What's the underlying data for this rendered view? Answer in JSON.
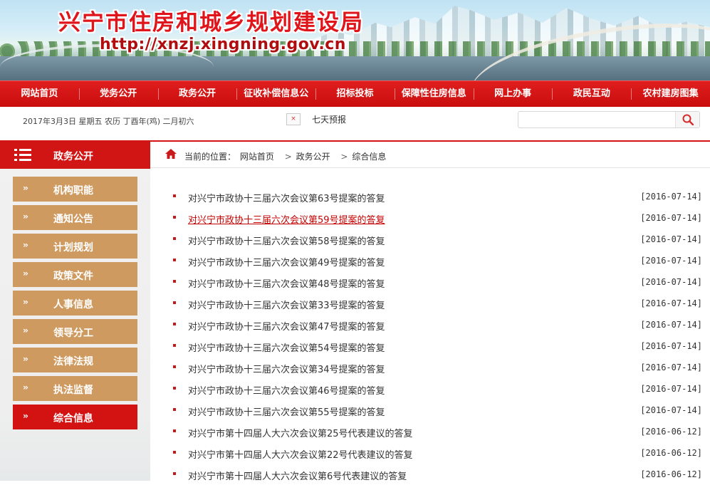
{
  "header": {
    "site_title": "兴宁市住房和城乡规划建设局",
    "site_url": "http://xnzj.xingning.gov.cn"
  },
  "nav": {
    "items": [
      "网站首页",
      "党务公开",
      "政务公开",
      "征收补偿信息公",
      "招标投标",
      "保障性住房信息",
      "网上办事",
      "政民互动",
      "农村建房图集"
    ]
  },
  "infobar": {
    "date_text": "2017年3月3日  星期五  农历  丁酉年(鸡)  二月初六",
    "weather_close": "×",
    "weather_link": "七天预报",
    "search_placeholder": ""
  },
  "sidebar": {
    "title": "政务公开",
    "arrow": "››",
    "items": [
      {
        "label": "机构职能"
      },
      {
        "label": "通知公告"
      },
      {
        "label": "计划规划"
      },
      {
        "label": "政策文件"
      },
      {
        "label": "人事信息"
      },
      {
        "label": "领导分工"
      },
      {
        "label": "法律法规"
      },
      {
        "label": "执法监督"
      },
      {
        "label": "综合信息"
      }
    ]
  },
  "breadcrumb": {
    "prefix": "当前的位置：",
    "path": [
      "网站首页",
      "政务公开",
      "综合信息"
    ],
    "separator": ">"
  },
  "articles": [
    {
      "title": "对兴宁市政协十三届六次会议第63号提案的答复",
      "date": "[2016-07-14]"
    },
    {
      "title": "对兴宁市政协十三届六次会议第59号提案的答复",
      "date": "[2016-07-14]",
      "hover": true
    },
    {
      "title": "对兴宁市政协十三届六次会议第58号提案的答复",
      "date": "[2016-07-14]"
    },
    {
      "title": "对兴宁市政协十三届六次会议第49号提案的答复",
      "date": "[2016-07-14]"
    },
    {
      "title": "对兴宁市政协十三届六次会议第48号提案的答复",
      "date": "[2016-07-14]"
    },
    {
      "title": "对兴宁市政协十三届六次会议第33号提案的答复",
      "date": "[2016-07-14]"
    },
    {
      "title": "对兴宁市政协十三届六次会议第47号提案的答复",
      "date": "[2016-07-14]"
    },
    {
      "title": "对兴宁市政协十三届六次会议第54号提案的答复",
      "date": "[2016-07-14]"
    },
    {
      "title": "对兴宁市政协十三届六次会议第34号提案的答复",
      "date": "[2016-07-14]"
    },
    {
      "title": "对兴宁市政协十三届六次会议第46号提案的答复",
      "date": "[2016-07-14]"
    },
    {
      "title": "对兴宁市政协十三届六次会议第55号提案的答复",
      "date": "[2016-07-14]"
    },
    {
      "title": "对兴宁市第十四届人大六次会议第25号代表建议的答复",
      "date": "[2016-06-12]"
    },
    {
      "title": "对兴宁市第十四届人大六次会议第22号代表建议的答复",
      "date": "[2016-06-12]"
    },
    {
      "title": "对兴宁市第十四届人大六次会议第6号代表建议的答复",
      "date": "[2016-06-12]"
    }
  ],
  "colors": {
    "brand_red": "#d11515",
    "sidebar_tan": "#cf9a5f"
  }
}
